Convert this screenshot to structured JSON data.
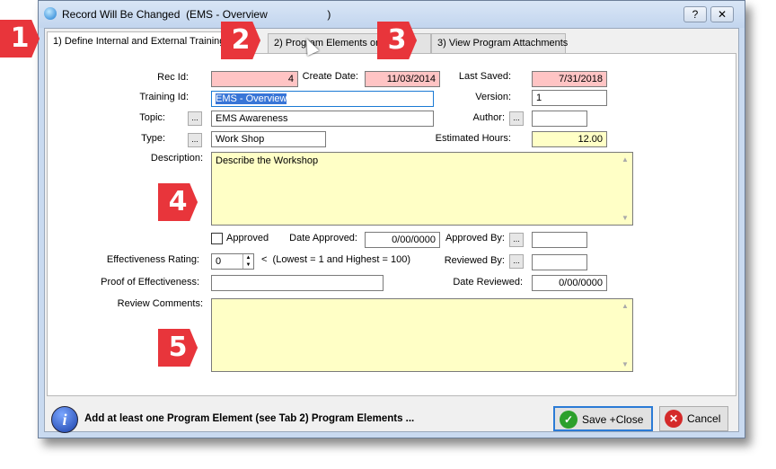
{
  "window": {
    "title": "Record Will Be Changed  (EMS - Overview                    )",
    "help": "?",
    "close": "✕"
  },
  "tabs": [
    {
      "label": "1) Define Internal and External Training"
    },
    {
      "label": "2) Program Elements or Co"
    },
    {
      "label": "3) View Program Attachments"
    }
  ],
  "badges": [
    "1",
    "2",
    "3",
    "4",
    "5"
  ],
  "form": {
    "rec_id_label": "Rec Id:",
    "rec_id": "4",
    "create_date_label": "Create Date:",
    "create_date": "11/03/2014",
    "last_saved_label": "Last Saved:",
    "last_saved": "7/31/2018",
    "training_id_label": "Training Id:",
    "training_id": "EMS - Overview",
    "version_label": "Version:",
    "version": "1",
    "topic_label": "Topic:",
    "topic": "EMS Awareness",
    "author_label": "Author:",
    "author": "",
    "type_label": "Type:",
    "type": "Work Shop",
    "hours_label": "Estimated Hours:",
    "hours": "12.00",
    "description_label": "Description:",
    "description": "Describe the Workshop",
    "approved_label": "Approved",
    "approved": false,
    "date_approved_label": "Date Approved:",
    "date_approved": "0/00/0000",
    "approved_by_label": "Approved By:",
    "approved_by": "",
    "effectiveness_label": "Effectiveness Rating:",
    "effectiveness": "0",
    "effectiveness_hint": "<  (Lowest = 1 and Highest = 100)",
    "reviewed_by_label": "Reviewed By:",
    "reviewed_by": "",
    "proof_label": "Proof of Effectiveness:",
    "proof": "",
    "date_reviewed_label": "Date Reviewed:",
    "date_reviewed": "0/00/0000",
    "review_comments_label": "Review Comments:",
    "review_comments": "",
    "dots": "..."
  },
  "footer": {
    "message": "Add at least one Program Element (see Tab 2) Program Elements ...",
    "save": "Save +Close",
    "cancel": "Cancel"
  },
  "colors": {
    "readonly": "#ffc4c4",
    "editable": "#ffffc6",
    "badge": "#e8353b"
  }
}
